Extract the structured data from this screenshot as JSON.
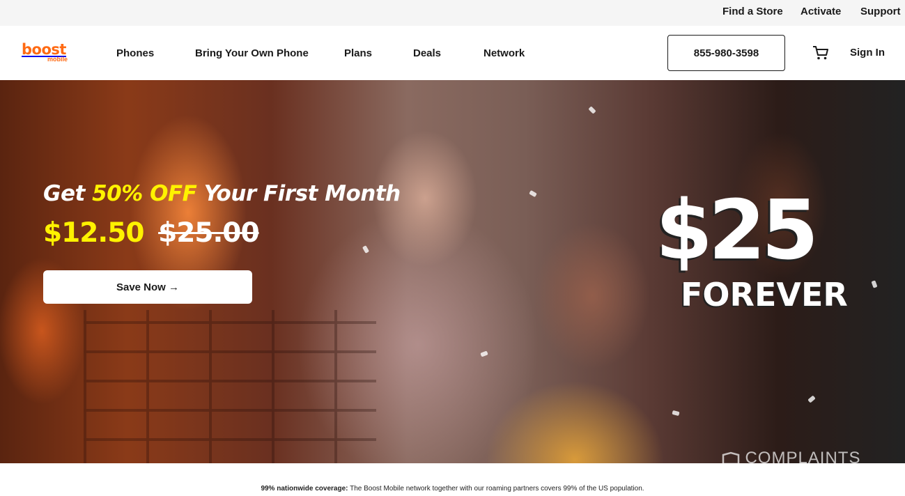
{
  "utility_nav": {
    "find_store": "Find a Store",
    "activate": "Activate",
    "support": "Support"
  },
  "brand": {
    "logo_main": "boost",
    "logo_sub": "mobile",
    "color": "#ff6a13"
  },
  "main_nav": {
    "items": [
      "Phones",
      "Bring Your Own Phone",
      "Plans",
      "Deals",
      "Network"
    ],
    "phone_number": "855-980-3598",
    "cart_icon": "cart-icon",
    "sign_in": "Sign In"
  },
  "hero": {
    "headline_prefix": "Get",
    "headline_highlight": "50% OFF",
    "headline_suffix": "Your First Month",
    "price_new": "$12.50",
    "price_old": "$25.00",
    "cta_label": "Save Now →",
    "promo_amount": "$25",
    "promo_text": "FOREVER",
    "accent_color": "#fff200"
  },
  "complaints_badge": {
    "label": "COMPLAINTS",
    "icon": "shield-icon"
  },
  "coverage": {
    "label": "99% nationwide coverage:",
    "text": "The Boost Mobile network together with our roaming partners covers 99% of the US population."
  }
}
